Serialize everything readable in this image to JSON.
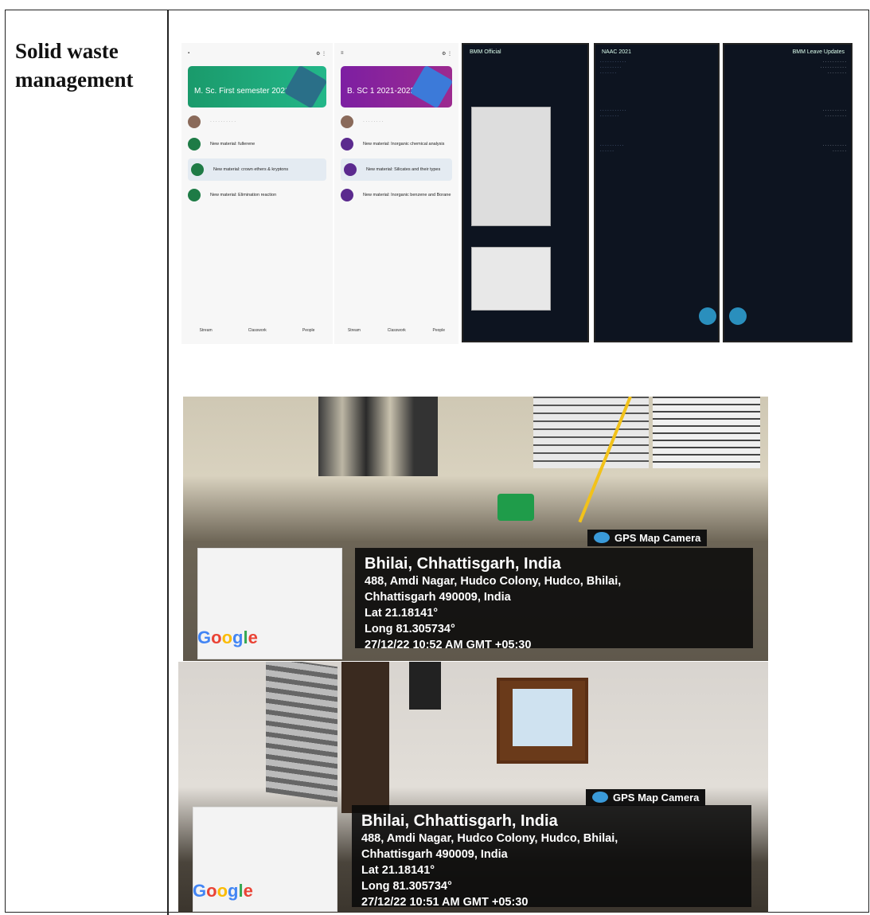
{
  "section_label": "Solid waste management",
  "screenshots": {
    "classroom_1": {
      "banner_title": "M. Sc. First semester 2021-22",
      "items": [
        "New material: fullerene",
        "New material: crown ethers & kryptons",
        "New material: Elimination reaction"
      ],
      "nav": [
        "Stream",
        "Classwork",
        "People"
      ]
    },
    "classroom_2": {
      "banner_title": "B. SC 1 2021-2022",
      "items": [
        "New material: Inorganic chemical analysis",
        "New material: Silicates and their types",
        "New material: Inorganic benzene and Borane"
      ],
      "nav": [
        "Stream",
        "Classwork",
        "People"
      ]
    },
    "chat_1": {
      "title": "BMM Official"
    },
    "chat_2": {
      "title": "NAAC 2021"
    },
    "chat_3": {
      "title": "BMM Leave Updates"
    }
  },
  "photos": [
    {
      "badge": "GPS Map Camera",
      "city": "Bhilai, Chhattisgarh, India",
      "address_line1": "488, Amdi Nagar, Hudco Colony, Hudco, Bhilai,",
      "address_line2": "Chhattisgarh 490009, India",
      "lat": "Lat 21.18141°",
      "long": "Long 81.305734°",
      "timestamp": "27/12/22 10:52 AM GMT +05:30",
      "map_logo": "Google"
    },
    {
      "badge": "GPS Map Camera",
      "city": "Bhilai, Chhattisgarh, India",
      "address_line1": "488, Amdi Nagar, Hudco Colony, Hudco, Bhilai,",
      "address_line2": "Chhattisgarh 490009, India",
      "lat": "Lat 21.18141°",
      "long": "Long 81.305734°",
      "timestamp": "27/12/22 10:51 AM GMT +05:30",
      "map_logo": "Google"
    }
  ]
}
